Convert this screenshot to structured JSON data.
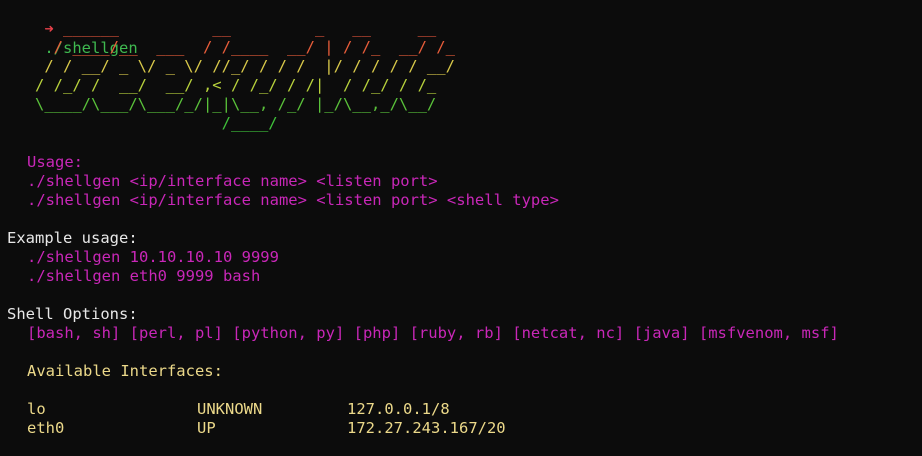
{
  "prompt": {
    "arrow": "➜",
    "command": "./shellgen"
  },
  "banner": [
    "      ______          __         _   __     __",
    "     / ____/__  ___  / /____  __/ | / /_  __/ /_",
    "    / / __/ _ \\/ _ \\/ //_/ / / /  |/ / / / / __/",
    "   / /_/ /  __/  __/ ,< / /_/ / /|  / /_/ / /_",
    "   \\____/\\___/\\___/_/|_|\\__, /_/ |_/\\__,_/\\__/",
    "                       /____/"
  ],
  "usage": {
    "heading": "Usage:",
    "lines": [
      "./shellgen <ip/interface name> <listen port>",
      "./shellgen <ip/interface name> <listen port> <shell type>"
    ]
  },
  "example": {
    "heading": "Example usage:",
    "lines": [
      "./shellgen 10.10.10.10 9999",
      "./shellgen eth0 9999 bash"
    ]
  },
  "shell_options": {
    "heading": "Shell Options:",
    "options": "[bash, sh] [perl, pl] [python, py] [php] [ruby, rb] [netcat, nc] [java] [msfvenom, msf]"
  },
  "interfaces": {
    "heading": "Available Interfaces:",
    "rows": [
      {
        "name": "lo",
        "state": "UNKNOWN",
        "address": "127.0.0.1/8"
      },
      {
        "name": "eth0",
        "state": "UP",
        "address": "172.27.243.167/20"
      }
    ]
  }
}
